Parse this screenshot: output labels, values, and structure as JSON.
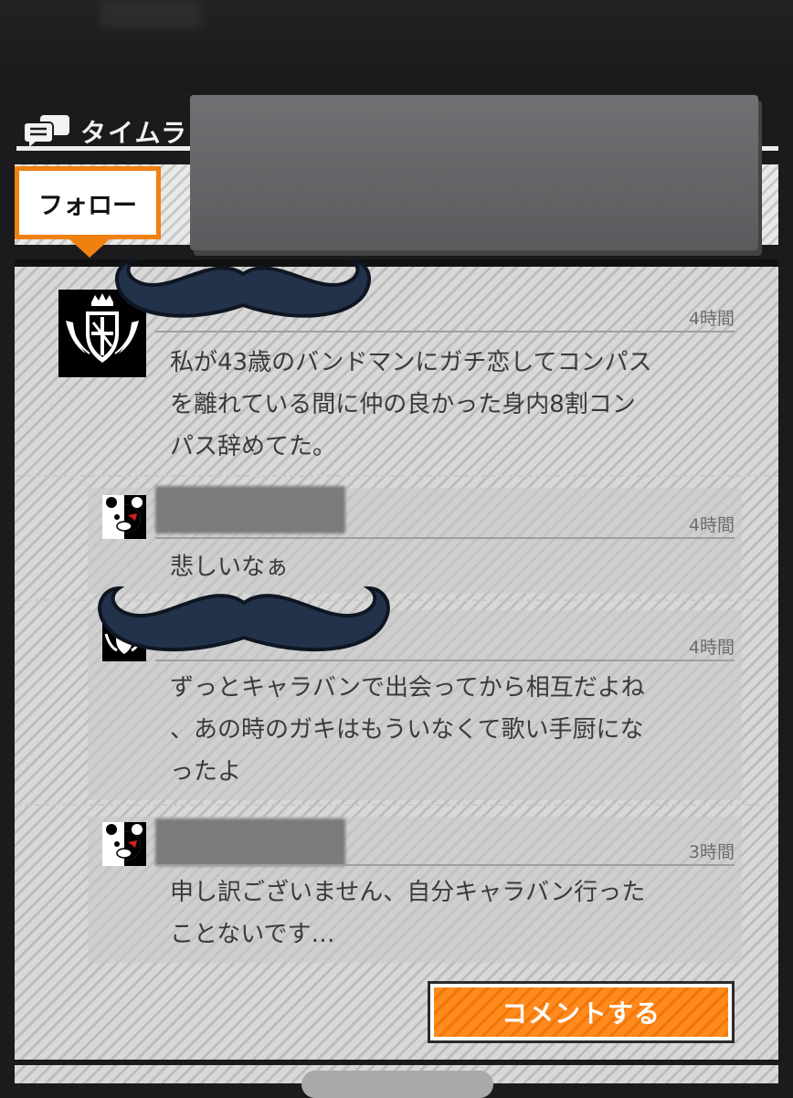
{
  "header": {
    "title": "タイムラ",
    "icon": "chat-bubbles-icon"
  },
  "tabs": {
    "follow_label": "フォロー"
  },
  "posts": {
    "main": {
      "time": "4時間",
      "text": "私が43歳のバンドマンにガチ恋してコンパス\nを離れている間に仲の良かった身内8割コン\nパス辞めてた。"
    },
    "replies": [
      {
        "time": "4時間",
        "text": "悲しいなぁ"
      },
      {
        "time": "4時間",
        "text": "ずっとキャラバンで出会ってから相互だよね\n、あの時のガキはもういなくて歌い手厨にな\nったよ"
      },
      {
        "time": "3時間",
        "text": "申し訳ございません、自分キャラバン行った\nことないです…"
      }
    ]
  },
  "actions": {
    "comment_label": "コメントする"
  },
  "colors": {
    "accent": "#f08010",
    "background": "#1b1b1d",
    "panel": "#d8d8d8"
  }
}
